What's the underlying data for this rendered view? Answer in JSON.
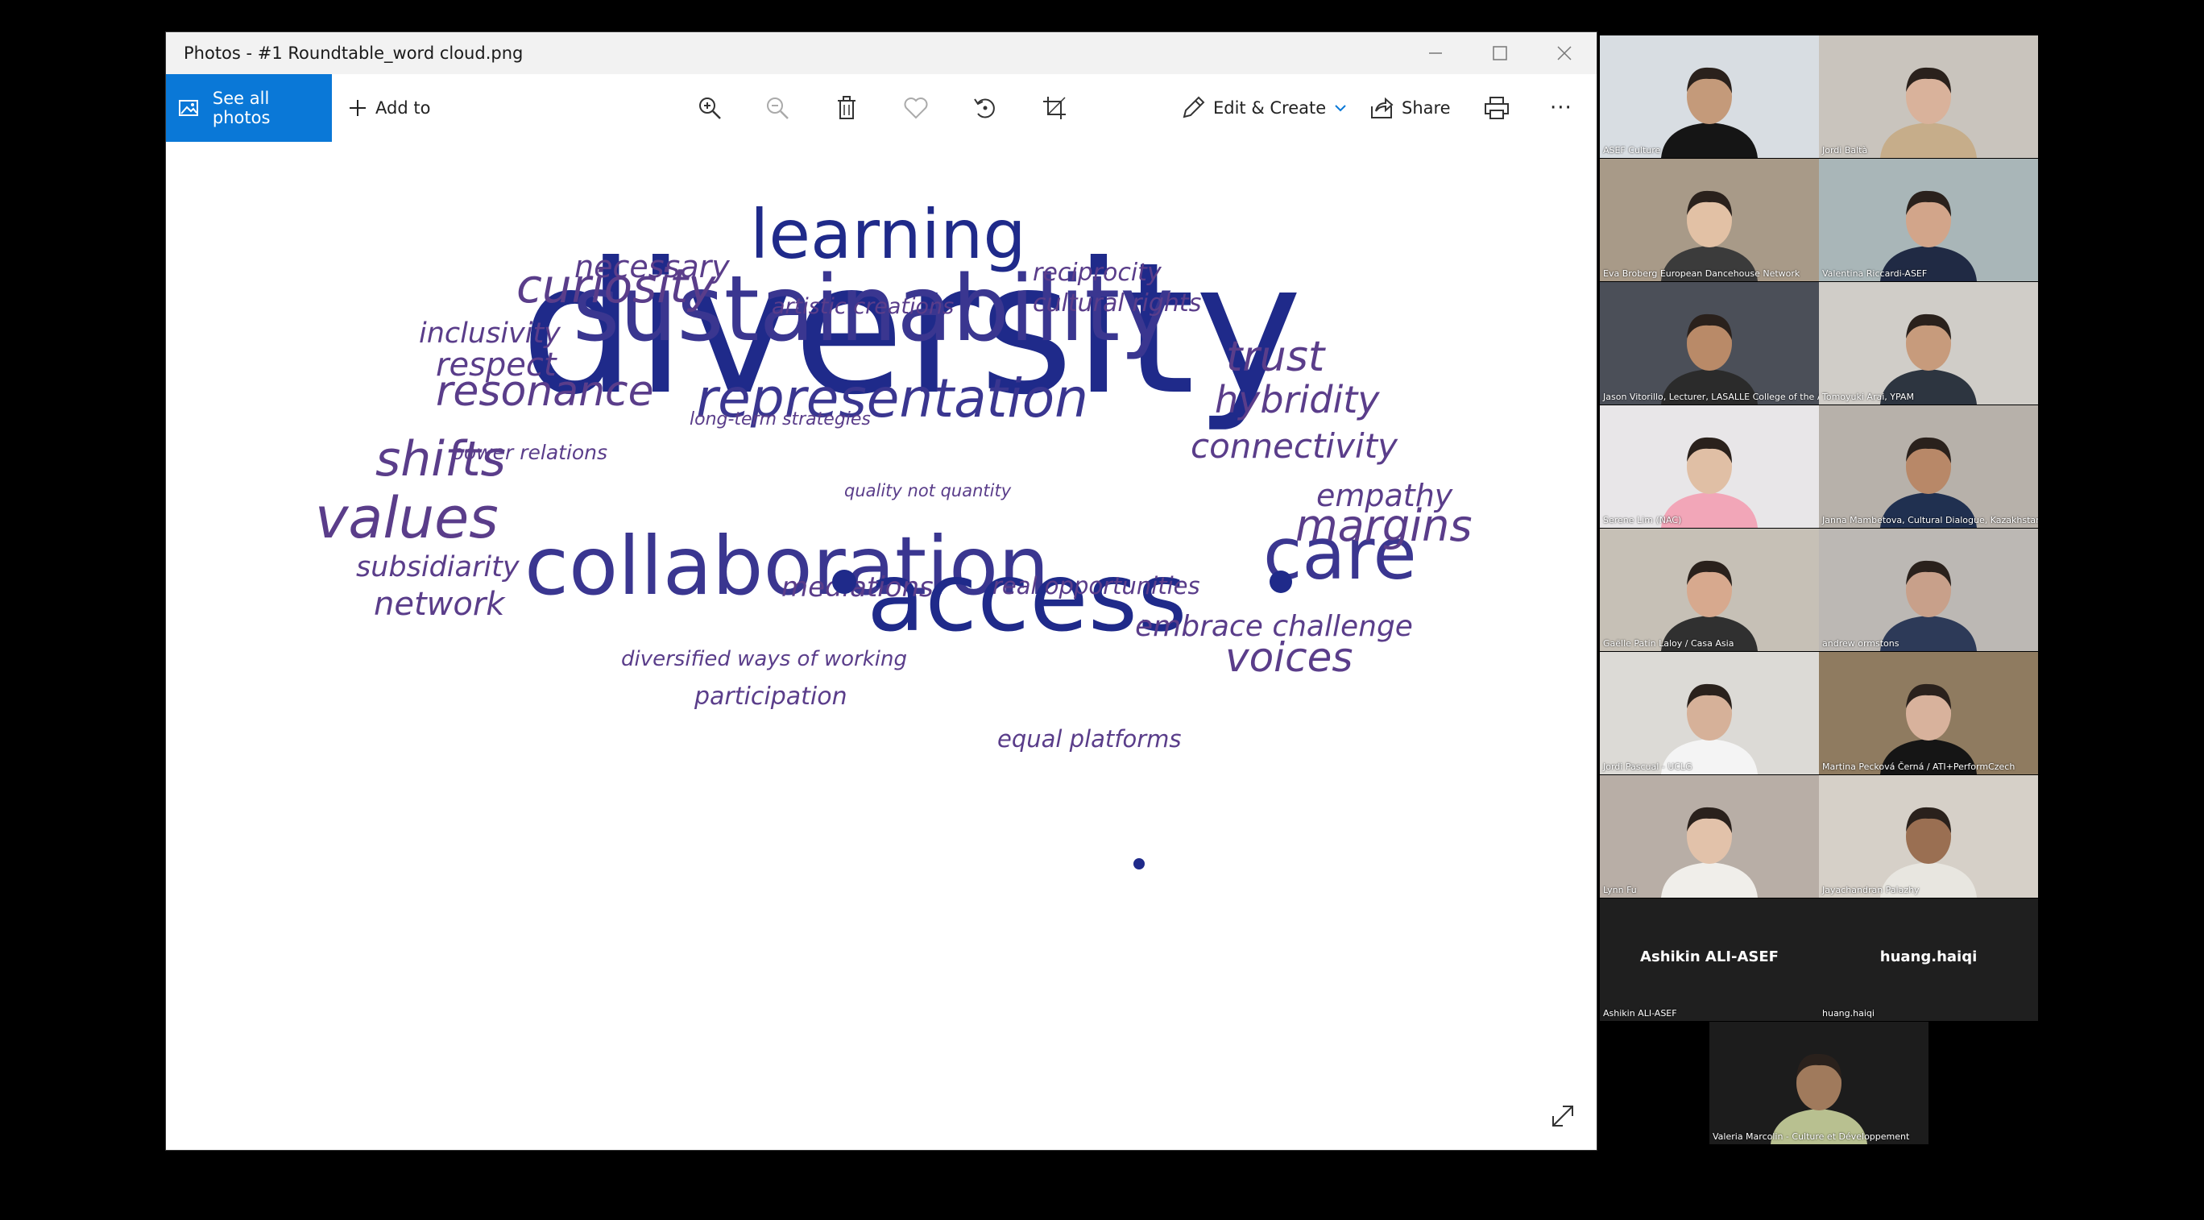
{
  "window": {
    "title": "Photos - #1 Roundtable_word cloud.png",
    "minimize_icon": "minimize-icon",
    "maximize_icon": "maximize-icon",
    "close_icon": "close-icon"
  },
  "toolbar": {
    "see_all_photos": "See all photos",
    "add_to": "Add to",
    "edit_create": "Edit & Create",
    "share": "Share",
    "more": "···"
  },
  "colors": {
    "accent": "#0a78d7",
    "navy": "#1f2a8a",
    "purple": "#5a3d8a",
    "mid": "#3a3690"
  },
  "word_cloud": [
    {
      "id": "diversity",
      "text": "diversity"
    },
    {
      "id": "sustainability",
      "text": "sustainability"
    },
    {
      "id": "collaboration",
      "text": "collaboration"
    },
    {
      "id": "access",
      "text": "access"
    },
    {
      "id": "learning",
      "text": "learning"
    },
    {
      "id": "representation",
      "text": "representation"
    },
    {
      "id": "care",
      "text": "care"
    },
    {
      "id": "values",
      "text": "values"
    },
    {
      "id": "curiosity",
      "text": "curiosity"
    },
    {
      "id": "shifts",
      "text": "shifts"
    },
    {
      "id": "resonance",
      "text": "resonance"
    },
    {
      "id": "trust",
      "text": "trust"
    },
    {
      "id": "hybridity",
      "text": "hybridity"
    },
    {
      "id": "connectivity",
      "text": "connectivity"
    },
    {
      "id": "margins",
      "text": "margins"
    },
    {
      "id": "empathy",
      "text": "empathy"
    },
    {
      "id": "voices",
      "text": "voices"
    },
    {
      "id": "embrace",
      "text": "embrace challenge"
    },
    {
      "id": "respect",
      "text": "respect"
    },
    {
      "id": "inclusivity",
      "text": "inclusivity"
    },
    {
      "id": "necessary",
      "text": "necessary"
    },
    {
      "id": "reciprocity",
      "text": "reciprocity"
    },
    {
      "id": "cultural_rights",
      "text": "cultural rights"
    },
    {
      "id": "artistic",
      "text": "artistic creations"
    },
    {
      "id": "long_term",
      "text": "long-term strategies"
    },
    {
      "id": "power",
      "text": "power relations"
    },
    {
      "id": "quality",
      "text": "quality not quantity"
    },
    {
      "id": "subsidiarity",
      "text": "subsidiarity"
    },
    {
      "id": "network",
      "text": "network"
    },
    {
      "id": "mediations",
      "text": "mediations"
    },
    {
      "id": "real_opp",
      "text": "real opportunities"
    },
    {
      "id": "diversified",
      "text": "diversified ways of working"
    },
    {
      "id": "participation",
      "text": "participation"
    },
    {
      "id": "equal",
      "text": "equal platforms"
    }
  ],
  "participants": [
    {
      "name": "ASEF Culture"
    },
    {
      "name": "Jordi Baltà"
    },
    {
      "name": "Eva Broberg European Dancehouse Network"
    },
    {
      "name": "Valentina Riccardi-ASEF"
    },
    {
      "name": "Jason Vitorillo, Lecturer, LASALLE College of the Arts"
    },
    {
      "name": "Tomoyuki Arai, YPAM"
    },
    {
      "name": "Serene Lim (NAC)"
    },
    {
      "name": "Janna Mambetova, Cultural Dialogue, Kazakhstan"
    },
    {
      "name": "Gaëlle Patin Laloy / Casa Asia"
    },
    {
      "name": "andrew ormstons"
    },
    {
      "name": "Jordi Pascual - UCLG"
    },
    {
      "name": "Martina Pecková Černá / ATI+PerformCzech"
    },
    {
      "name": "Lynn Fu"
    },
    {
      "name": "Jayachandran Palazhy"
    },
    {
      "name": "Ashikin ALI-ASEF",
      "display": "Ashikin ALI-ASEF"
    },
    {
      "name": "huang.haiqi",
      "display": "huang.haiqi"
    },
    {
      "name": "Valeria Marcolin - Culture et Développement"
    }
  ]
}
